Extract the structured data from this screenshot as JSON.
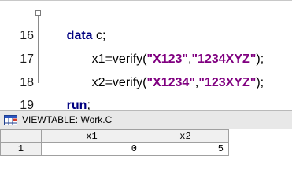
{
  "editor": {
    "lines": [
      {
        "number": "16",
        "tokens": [
          {
            "t": "data",
            "k": "kw"
          },
          {
            "t": " c;",
            "k": "plain"
          }
        ]
      },
      {
        "number": "17",
        "tokens": [
          {
            "t": "x1=verify(",
            "k": "plain"
          },
          {
            "t": "\"X123\"",
            "k": "str"
          },
          {
            "t": ",",
            "k": "plain"
          },
          {
            "t": "\"1234XYZ\"",
            "k": "str"
          },
          {
            "t": ");",
            "k": "plain"
          }
        ]
      },
      {
        "number": "18",
        "tokens": [
          {
            "t": "x2=verify(",
            "k": "plain"
          },
          {
            "t": "\"X1234\"",
            "k": "str"
          },
          {
            "t": ",",
            "k": "plain"
          },
          {
            "t": "\"123XYZ\"",
            "k": "str"
          },
          {
            "t": ");",
            "k": "plain"
          }
        ]
      },
      {
        "number": "19",
        "tokens": [
          {
            "t": "run",
            "k": "kw"
          },
          {
            "t": ";",
            "k": "plain"
          }
        ]
      }
    ],
    "colors": {
      "keyword": "#000080",
      "string": "#800080",
      "text": "#000000"
    }
  },
  "viewtable": {
    "title": "VIEWTABLE: Work.C",
    "icon": "table-icon",
    "columns": [
      "x1",
      "x2"
    ],
    "rows": [
      {
        "row_number": "1",
        "values": [
          "0",
          "5"
        ]
      }
    ]
  }
}
